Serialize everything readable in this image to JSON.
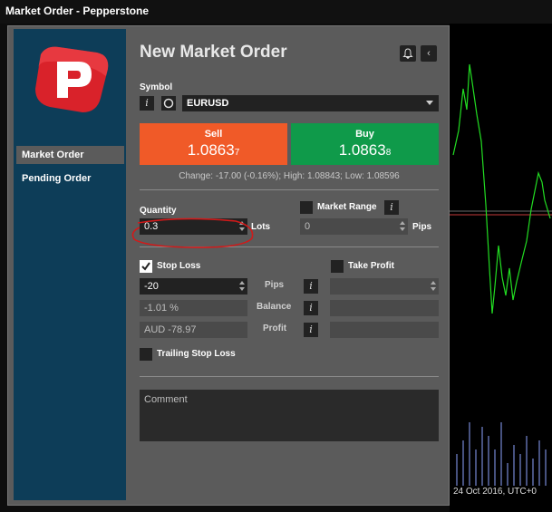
{
  "window": {
    "title": "Market Order - Pepperstone"
  },
  "sidebar": {
    "items": [
      {
        "label": "Market Order",
        "active": true
      },
      {
        "label": "Pending Order",
        "active": false
      }
    ]
  },
  "order": {
    "title": "New Market Order",
    "symbol_label": "Symbol",
    "symbol_value": "EURUSD",
    "sell": {
      "label": "Sell",
      "price_main": "1.0863",
      "price_small": "7"
    },
    "buy": {
      "label": "Buy",
      "price_main": "1.0863",
      "price_small": "8"
    },
    "info_line": "Change: -17.00 (-0.16%); High: 1.08843; Low: 1.08596",
    "quantity_label": "Quantity",
    "quantity_value": "0.3",
    "lots_label": "Lots",
    "market_range_label": "Market Range",
    "market_range_value": "0",
    "pips_label": "Pips",
    "stop_loss": {
      "label": "Stop Loss",
      "checked": true,
      "pips": "-20",
      "balance": "-1.01 %",
      "profit": "AUD -78.97"
    },
    "take_profit": {
      "label": "Take Profit",
      "checked": false
    },
    "row_labels": {
      "pips": "Pips",
      "balance": "Balance",
      "profit": "Profit"
    },
    "trailing_label": "Trailing Stop Loss",
    "comment_placeholder": "Comment"
  },
  "chart": {
    "date_label": "24 Oct 2016, UTC+0"
  },
  "colors": {
    "sell": "#f05a28",
    "buy": "#0f9a4a",
    "sidebar": "#0d3d58",
    "annotation": "#d11a1a"
  }
}
